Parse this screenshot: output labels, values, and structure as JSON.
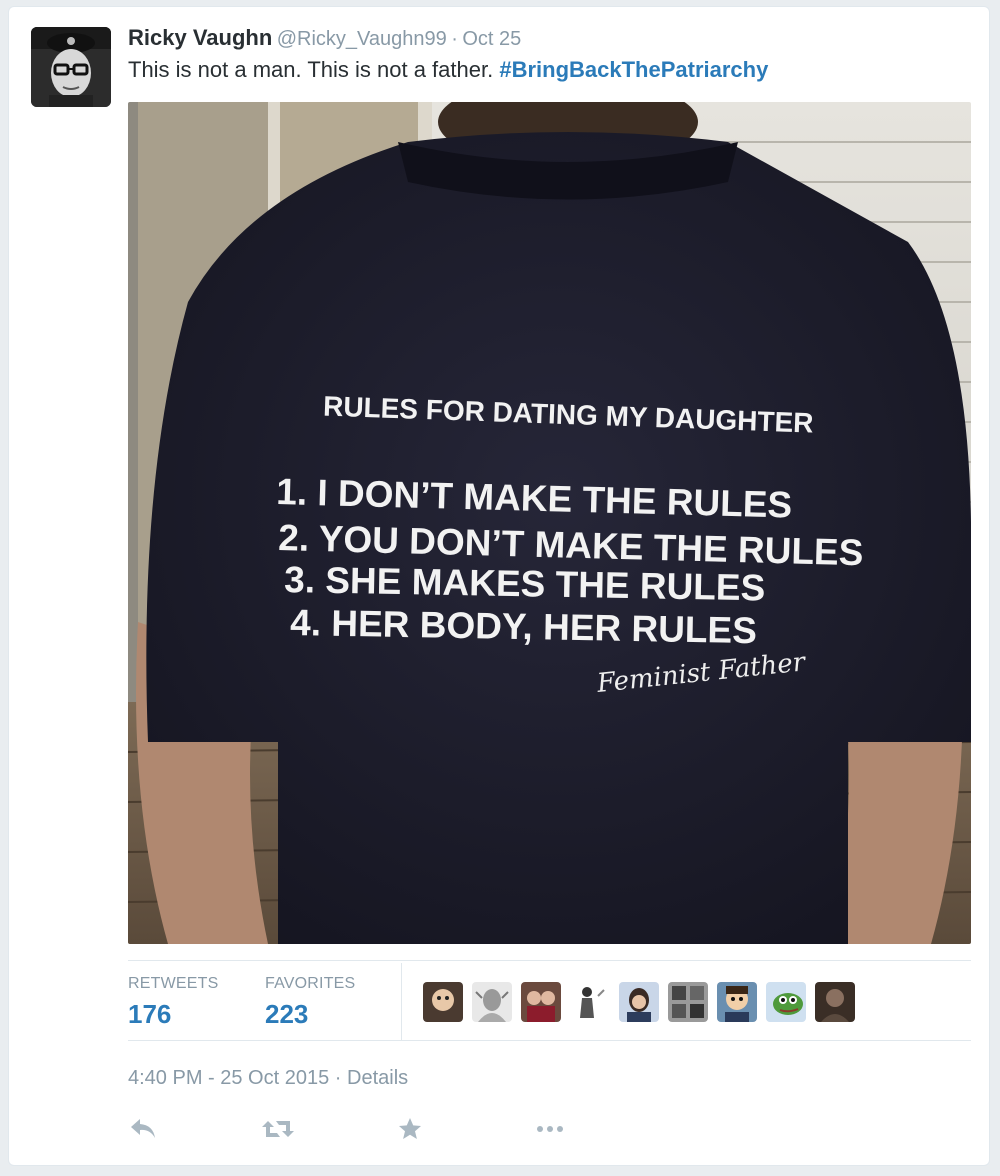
{
  "tweet": {
    "fullname": "Ricky Vaughn",
    "handle": "@Ricky_Vaughn99",
    "separator": "·",
    "date": "Oct 25",
    "text": "This is not a man. This is not a father. ",
    "hashtag": "#BringBackThePatriarchy"
  },
  "media": {
    "shirt_title": "RULES FOR DATING MY DAUGHTER",
    "rules": [
      "1. I DON’T MAKE THE RULES",
      "2. YOU DON’T MAKE THE RULES",
      "3. SHE MAKES THE RULES",
      "4. HER BODY, HER RULES"
    ],
    "signature": "Feminist Father"
  },
  "stats": {
    "retweets_label": "RETWEETS",
    "retweets": "176",
    "favorites_label": "FAVORITES",
    "favorites": "223"
  },
  "favoriter_count": 9,
  "footer": {
    "timestamp": "4:40 PM - 25 Oct 2015",
    "separator": "·",
    "details": "Details"
  },
  "actions": {
    "reply_icon": "reply-icon",
    "retweet_icon": "retweet-icon",
    "favorite_icon": "star-icon",
    "more_icon": "more-icon"
  },
  "colors": {
    "link": "#2b7bb9",
    "muted": "#8899a6",
    "text": "#292f33",
    "shirt": "#1c1c2a"
  }
}
